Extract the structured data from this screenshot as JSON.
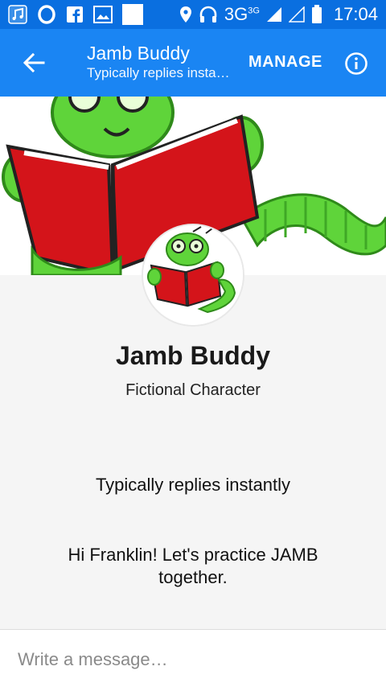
{
  "status_bar": {
    "network_label": "3G",
    "network_sup": "3G",
    "time": "17:04"
  },
  "app_bar": {
    "title": "Jamb Buddy",
    "subtitle": "Typically replies instantly",
    "manage_label": "MANAGE"
  },
  "profile": {
    "name": "Jamb Buddy",
    "category": "Fictional Character",
    "response_time": "Typically replies instantly",
    "greeting": "Hi Franklin! Let's practice JAMB together."
  },
  "composer": {
    "placeholder": "Write a message…"
  },
  "colors": {
    "status_bar": "#0a6fe0",
    "app_bar": "#1a85f3",
    "worm_green": "#5fd43a",
    "book_red": "#d4141a"
  }
}
